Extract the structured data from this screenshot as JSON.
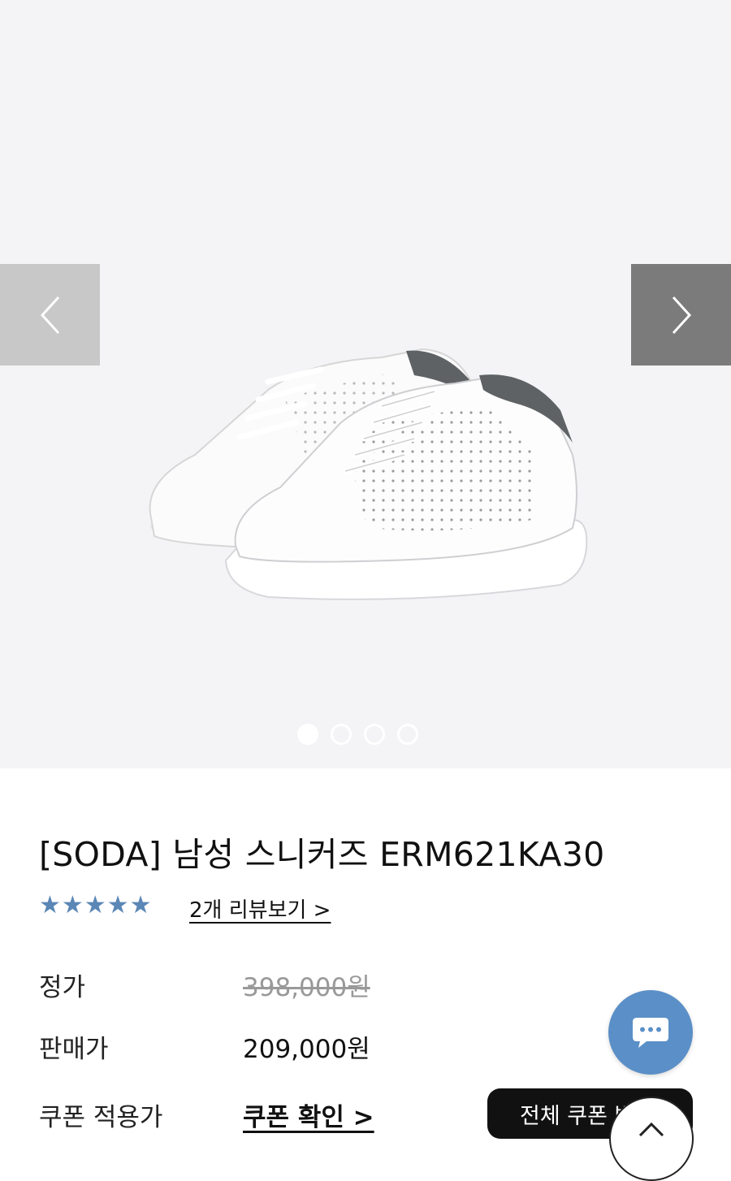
{
  "product": {
    "title": "[SODA] 남성 스니커즈 ERM621KA30",
    "rating_stars": "★★★★★",
    "review_link": "2개 리뷰보기 >"
  },
  "gallery": {
    "image_count": 4,
    "active_index": 0
  },
  "prices": {
    "list_label": "정가",
    "list_value": "398,000원",
    "sale_label": "판매가",
    "sale_value": "209,000원",
    "coupon_label": "쿠폰 적용가",
    "coupon_link": "쿠폰 확인 >"
  },
  "buttons": {
    "all_coupons": "전체 쿠폰 받"
  },
  "icons": {
    "prev": "chevron-left-icon",
    "next": "chevron-right-icon",
    "chat": "chat-bubble-icon",
    "top": "chevron-up-icon"
  },
  "colors": {
    "star": "#5b87b6",
    "chat_button": "#5b8fc7",
    "coupon_button": "#111111"
  }
}
